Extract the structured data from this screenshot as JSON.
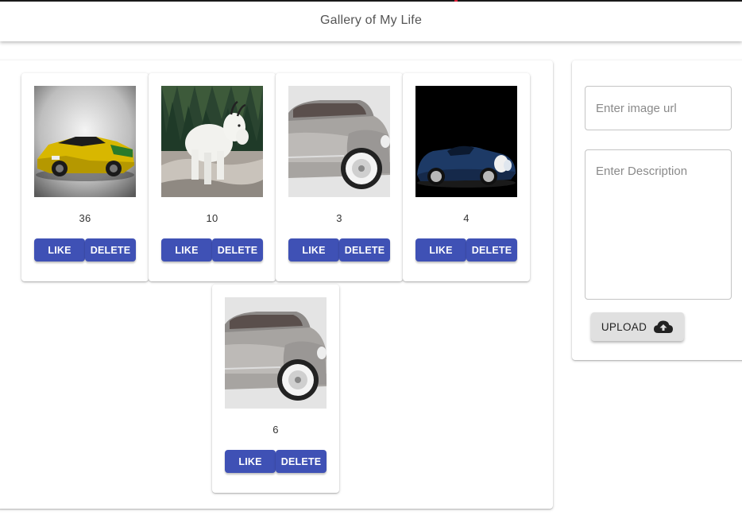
{
  "app": {
    "title": "Gallery of My Life"
  },
  "gallery": {
    "cards": [
      {
        "count": "36",
        "image": "yellow-sports-car",
        "like_label": "LIKE",
        "delete_label": "DELETE"
      },
      {
        "count": "10",
        "image": "mountain-goat",
        "like_label": "LIKE",
        "delete_label": "DELETE"
      },
      {
        "count": "3",
        "image": "silver-vintage-car",
        "like_label": "LIKE",
        "delete_label": "DELETE"
      },
      {
        "count": "4",
        "image": "blue-racing-car",
        "like_label": "LIKE",
        "delete_label": "DELETE"
      },
      {
        "count": "6",
        "image": "silver-vintage-car",
        "like_label": "LIKE",
        "delete_label": "DELETE"
      }
    ]
  },
  "upload": {
    "url_placeholder": "Enter image url",
    "url_value": "",
    "description_placeholder": "Enter Description",
    "description_value": "",
    "button_label": "UPLOAD",
    "button_icon": "cloud-upload-icon"
  },
  "colors": {
    "primary": "#3f51b5",
    "upload_button": "#e0e0e0"
  }
}
